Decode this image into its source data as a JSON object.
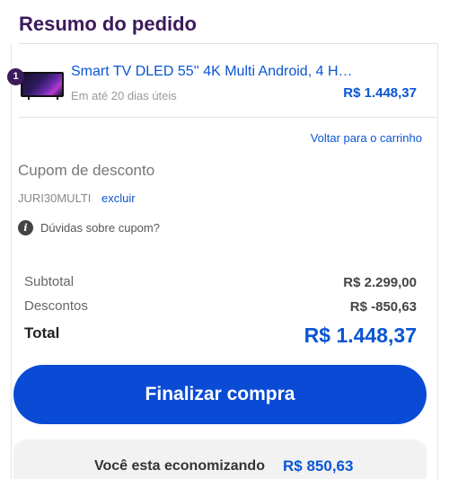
{
  "summary": {
    "title": "Resumo do pedido"
  },
  "product": {
    "quantity": "1",
    "name": "Smart TV DLED 55'' 4K Multi Android, 4 H…",
    "delivery": "Em até 20 dias úteis",
    "price": "R$ 1.448,37",
    "thumbnail_icon": "tv-thumbnail"
  },
  "links": {
    "back_to_cart": "Voltar para o carrinho"
  },
  "coupon": {
    "title": "Cupom de desconto",
    "code": "JURI30MULTI",
    "remove_label": "excluir",
    "help_label": "Dúvidas sobre cupom?",
    "help_icon": "info-icon"
  },
  "totals": {
    "subtotal_label": "Subtotal",
    "subtotal_value": "R$ 2.299,00",
    "discount_label": "Descontos",
    "discount_value": "R$ -850,63",
    "total_label": "Total",
    "total_value": "R$ 1.448,37"
  },
  "actions": {
    "checkout_label": "Finalizar compra"
  },
  "savings": {
    "text": "Você esta economizando",
    "value": "R$ 850,63"
  },
  "colors": {
    "brand_purple": "#3c1a5b",
    "link_blue": "#0a55d1",
    "button_blue": "#0a4bd6"
  }
}
